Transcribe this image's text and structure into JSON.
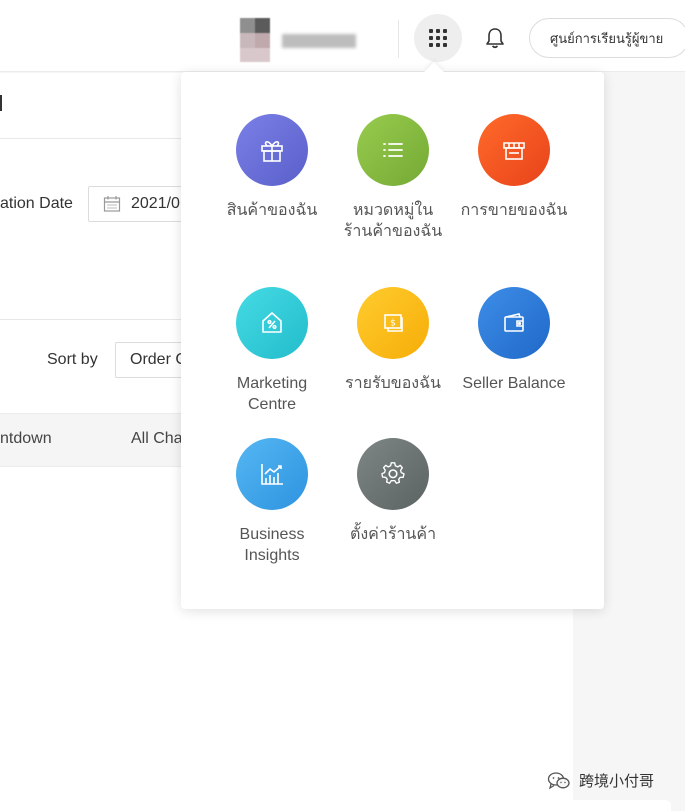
{
  "header": {
    "learning_center": "ศูนย์การเรียนรู้ผู้ขาย"
  },
  "page": {
    "creation_date_label": "ation Date",
    "creation_date_value": "2021/0",
    "sort_by_label": "Sort by",
    "sort_by_value": "Order C",
    "table_headers": [
      "ntdown",
      "All Cha"
    ]
  },
  "apps_menu": {
    "items": [
      {
        "label": "สินค้าของฉัน",
        "icon": "gift-icon",
        "color": "#6b6fd6"
      },
      {
        "label": "หมวดหมู่ในร้านค้าของฉัน",
        "icon": "list-icon",
        "color": "#86bc3f"
      },
      {
        "label": "การขายของฉัน",
        "icon": "store-icon",
        "color": "#f25322"
      },
      {
        "label": "Marketing Centre",
        "icon": "discount-tag-icon",
        "color": "#30cdd6"
      },
      {
        "label": "รายรับของฉัน",
        "icon": "money-icon",
        "color": "#fbbd16"
      },
      {
        "label": "Seller Balance",
        "icon": "wallet-icon",
        "color": "#2f7fdb"
      },
      {
        "label": "Business Insights",
        "icon": "chart-icon",
        "color": "#3ea3ea"
      },
      {
        "label": "ตั้งค่าร้านค้า",
        "icon": "gear-icon",
        "color": "#6b7472"
      }
    ]
  },
  "watermark": {
    "text": "跨境小付哥"
  }
}
